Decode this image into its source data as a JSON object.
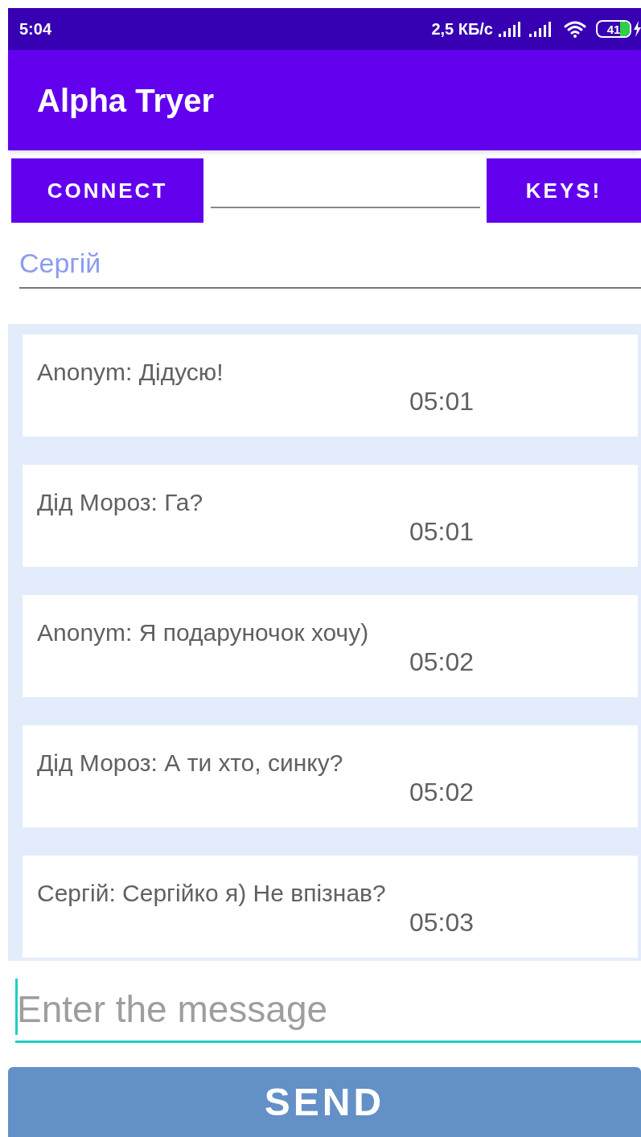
{
  "status_bar": {
    "time": "5:04",
    "speed": "2,5 КБ/с",
    "battery": "41"
  },
  "app_bar": {
    "title": "Alpha Tryer"
  },
  "controls": {
    "connect_button": "CONNECT",
    "keys_button": "KEYS!"
  },
  "name_field": {
    "value": "Сергій"
  },
  "messages": [
    {
      "text": "Anonym: Дідусю!",
      "time": "05:01"
    },
    {
      "text": "Дід Мороз: Га?",
      "time": "05:01"
    },
    {
      "text": "Anonym: Я подаруночок хочу)",
      "time": "05:02"
    },
    {
      "text": "Дід Мороз: А ти хто, синку?",
      "time": "05:02"
    },
    {
      "text": "Сергій: Сергійко я) Не впізнав?",
      "time": "05:03"
    }
  ],
  "message_field": {
    "placeholder": "Enter the message",
    "focused": true
  },
  "send_button": "SEND"
}
